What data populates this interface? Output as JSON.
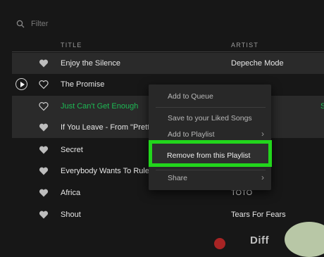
{
  "filter": {
    "placeholder": "Filter"
  },
  "columns": {
    "title": "TITLE",
    "artist": "ARTIST"
  },
  "tracks": [
    {
      "title": "Enjoy the Silence",
      "artist": "Depeche Mode",
      "edge": ""
    },
    {
      "title": "The Promise",
      "artist": "",
      "edge": ""
    },
    {
      "title": "Just Can't Get Enough",
      "artist": "",
      "edge": "S"
    },
    {
      "title": "If You Leave - From \"Pretty",
      "artist": "",
      "edge": ""
    },
    {
      "title": "Secret",
      "artist": "",
      "edge": ""
    },
    {
      "title": "Everybody Wants To Rule",
      "artist": "",
      "edge": ""
    },
    {
      "title": "Africa",
      "artist": "TOTO",
      "edge": ""
    },
    {
      "title": "Shout",
      "artist": "Tears For Fears",
      "edge": ""
    }
  ],
  "menu": {
    "add_to_queue": "Add to Queue",
    "save_liked": "Save to your Liked Songs",
    "add_to_playlist": "Add to Playlist",
    "remove": "Remove from this Playlist",
    "share": "Share"
  },
  "partial_text": "Diff",
  "colors": {
    "accent_green": "#1db954",
    "highlight_box": "#22d61c"
  }
}
